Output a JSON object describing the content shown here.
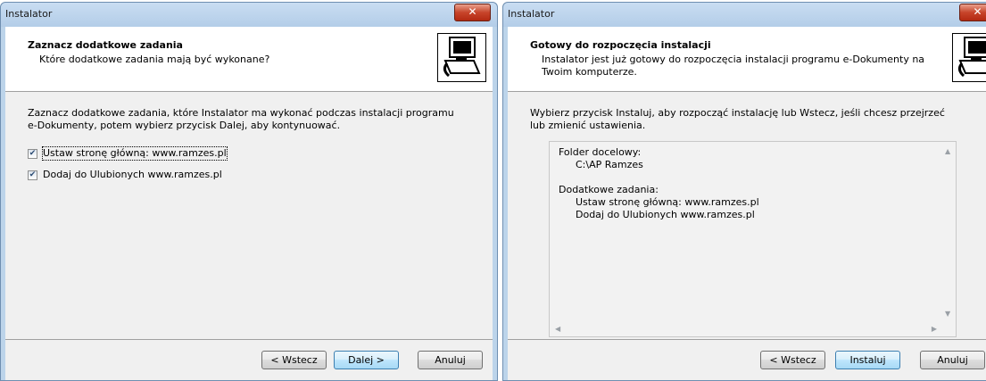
{
  "left_window": {
    "title": "Instalator",
    "header_title": "Zaznacz dodatkowe zadania",
    "header_subtitle": "Które dodatkowe zadania mają być wykonane?",
    "intro_line1": "Zaznacz dodatkowe zadania, które Instalator ma wykonać podczas instalacji programu",
    "intro_line2": "e-Dokumenty, potem wybierz przycisk Dalej, aby kontynuować.",
    "tasks": [
      {
        "label": "Ustaw stronę główną: www.ramzes.pl",
        "checked": true
      },
      {
        "label": "Dodaj do Ulubionych www.ramzes.pl",
        "checked": true
      }
    ],
    "buttons": {
      "back": "< Wstecz",
      "next": "Dalej >",
      "cancel": "Anuluj"
    }
  },
  "right_window": {
    "title": "Instalator",
    "header_title": "Gotowy do rozpoczęcia instalacji",
    "header_subtitle_line1": "Instalator jest już gotowy do rozpoczęcia instalacji programu e-Dokumenty na",
    "header_subtitle_line2": "Twoim komputerze.",
    "intro_line1": "Wybierz przycisk Instaluj, aby rozpocząć instalację lub Wstecz, jeśli chcesz przejrzeć",
    "intro_line2": "lub zmienić ustawienia.",
    "memo": {
      "folder_label": "Folder docelowy:",
      "folder_value": "C:\\AP Ramzes",
      "tasks_label": "Dodatkowe zadania:",
      "tasks": [
        "Ustaw stronę główną: www.ramzes.pl",
        "Dodaj do Ulubionych www.ramzes.pl"
      ]
    },
    "buttons": {
      "back": "< Wstecz",
      "install": "Instaluj",
      "cancel": "Anuluj"
    }
  },
  "icons": {
    "close": "close-icon",
    "wizard": "installer-computer-icon",
    "check": "check-icon"
  },
  "colors": {
    "frame": "#bcd4ea",
    "client": "#f0f0f0",
    "close": "#c7442a",
    "default_button": "#3c7fb1"
  }
}
